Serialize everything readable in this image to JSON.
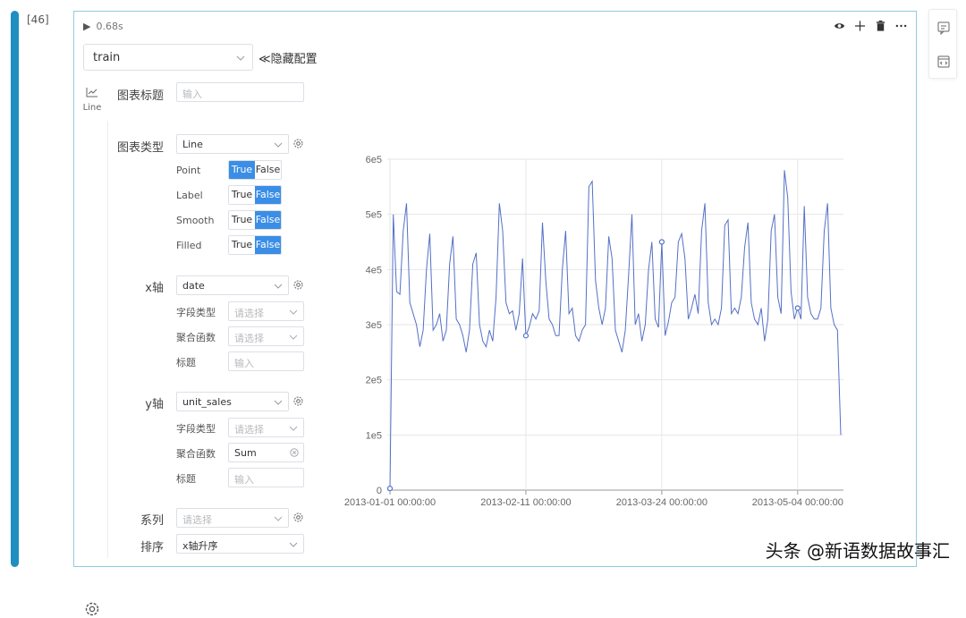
{
  "cell": {
    "execution_count": "[46]",
    "run_time": "0.68s"
  },
  "toolbar": {
    "icons": [
      "eye-icon",
      "plus-icon",
      "trash-icon",
      "more-icon"
    ]
  },
  "side_tools": {
    "icons": [
      "comment-icon",
      "code-panel-icon"
    ]
  },
  "dataset": {
    "selected": "train",
    "hide_config_label": "≪隐藏配置"
  },
  "tabs": [
    {
      "label": "Line",
      "icon": "line-chart-icon"
    }
  ],
  "form": {
    "chart_title": {
      "label": "图表标题",
      "placeholder": "输入"
    },
    "chart_type": {
      "label": "图表类型",
      "value": "Line"
    },
    "toggles": [
      {
        "label": "Point",
        "true_label": "True",
        "false_label": "False",
        "value": "True"
      },
      {
        "label": "Label",
        "true_label": "True",
        "false_label": "False",
        "value": "False"
      },
      {
        "label": "Smooth",
        "true_label": "True",
        "false_label": "False",
        "value": "False"
      },
      {
        "label": "Filled",
        "true_label": "True",
        "false_label": "False",
        "value": "False"
      }
    ],
    "x_axis": {
      "label": "x轴",
      "field": "date",
      "field_type_label": "字段类型",
      "field_type_placeholder": "请选择",
      "agg_label": "聚合函数",
      "agg_placeholder": "请选择",
      "title_label": "标题",
      "title_placeholder": "输入"
    },
    "y_axis": {
      "label": "y轴",
      "field": "unit_sales",
      "field_type_label": "字段类型",
      "field_type_placeholder": "请选择",
      "agg_label": "聚合函数",
      "agg_value": "Sum",
      "title_label": "标题",
      "title_placeholder": "输入"
    },
    "series": {
      "label": "系列",
      "placeholder": "请选择"
    },
    "sort": {
      "label": "排序",
      "value": "x轴升序"
    }
  },
  "chart_data": {
    "type": "line",
    "title": "",
    "xlabel": "",
    "ylabel": "",
    "x_ticks": [
      "2013-01-01 00:00:00",
      "2013-02-11 00:00:00",
      "2013-03-24 00:00:00",
      "2013-05-04 00:00:00"
    ],
    "y_ticks": [
      "0",
      "1e5",
      "2e5",
      "3e5",
      "4e5",
      "5e5",
      "6e5"
    ],
    "ylim": [
      0,
      600000
    ],
    "x_range": [
      "2013-01-01",
      "2013-06-02"
    ],
    "grid": true,
    "line_color": "#5470c6",
    "series": [
      {
        "x_start": "2013-01-01",
        "x_step_days": 1,
        "point_markers_at_index": [
          0,
          41,
          82,
          123
        ],
        "values": [
          3000,
          500000,
          360000,
          355000,
          470000,
          520000,
          340000,
          320000,
          300000,
          260000,
          290000,
          400000,
          465000,
          290000,
          300000,
          320000,
          270000,
          290000,
          410000,
          460000,
          310000,
          300000,
          280000,
          250000,
          290000,
          410000,
          430000,
          300000,
          270000,
          260000,
          290000,
          270000,
          350000,
          520000,
          470000,
          340000,
          320000,
          325000,
          290000,
          320000,
          420000,
          280000,
          295000,
          320000,
          310000,
          325000,
          485000,
          380000,
          310000,
          300000,
          280000,
          280000,
          400000,
          470000,
          320000,
          330000,
          280000,
          270000,
          290000,
          300000,
          550000,
          560000,
          380000,
          330000,
          300000,
          330000,
          460000,
          420000,
          290000,
          270000,
          250000,
          290000,
          390000,
          500000,
          300000,
          320000,
          270000,
          300000,
          400000,
          450000,
          310000,
          295000,
          450000,
          280000,
          305000,
          340000,
          350000,
          450000,
          465000,
          420000,
          310000,
          330000,
          355000,
          320000,
          470000,
          520000,
          340000,
          300000,
          310000,
          300000,
          330000,
          480000,
          490000,
          320000,
          330000,
          320000,
          350000,
          440000,
          485000,
          340000,
          310000,
          300000,
          330000,
          270000,
          310000,
          470000,
          500000,
          350000,
          320000,
          580000,
          530000,
          360000,
          310000,
          330000,
          310000,
          515000,
          350000,
          320000,
          310000,
          310000,
          330000,
          470000,
          520000,
          330000,
          300000,
          290000,
          100000
        ]
      }
    ]
  },
  "watermark": "头条 @新语数据故事汇"
}
